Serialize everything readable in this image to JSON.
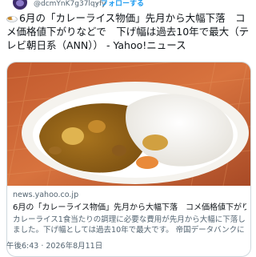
{
  "user": {
    "handle": "@dcmYnK7g37lqyfy",
    "separator": "·",
    "follow_label": "フォローする"
  },
  "tweet": {
    "text": "6月の「カレーライス物価」先月から大幅下落　コメ価格値下がりなどで　下げ幅は過去10年で最大（テレビ朝日系（ANN）） - Yahoo!ニュース",
    "emoji_icon": "curry-rice-icon"
  },
  "card": {
    "domain": "news.yahoo.co.jp",
    "title": "6月の「カレーライス物価」先月から大幅下落　コメ価格値下がりなど…",
    "description": "カレーライス1食当たりの調理に必要な費用が先月から大幅に下落しました。下げ幅としては過去10年で最大です。 帝国データバンクによります"
  },
  "timestamp": "午後6:43 · 2026年8月11日"
}
